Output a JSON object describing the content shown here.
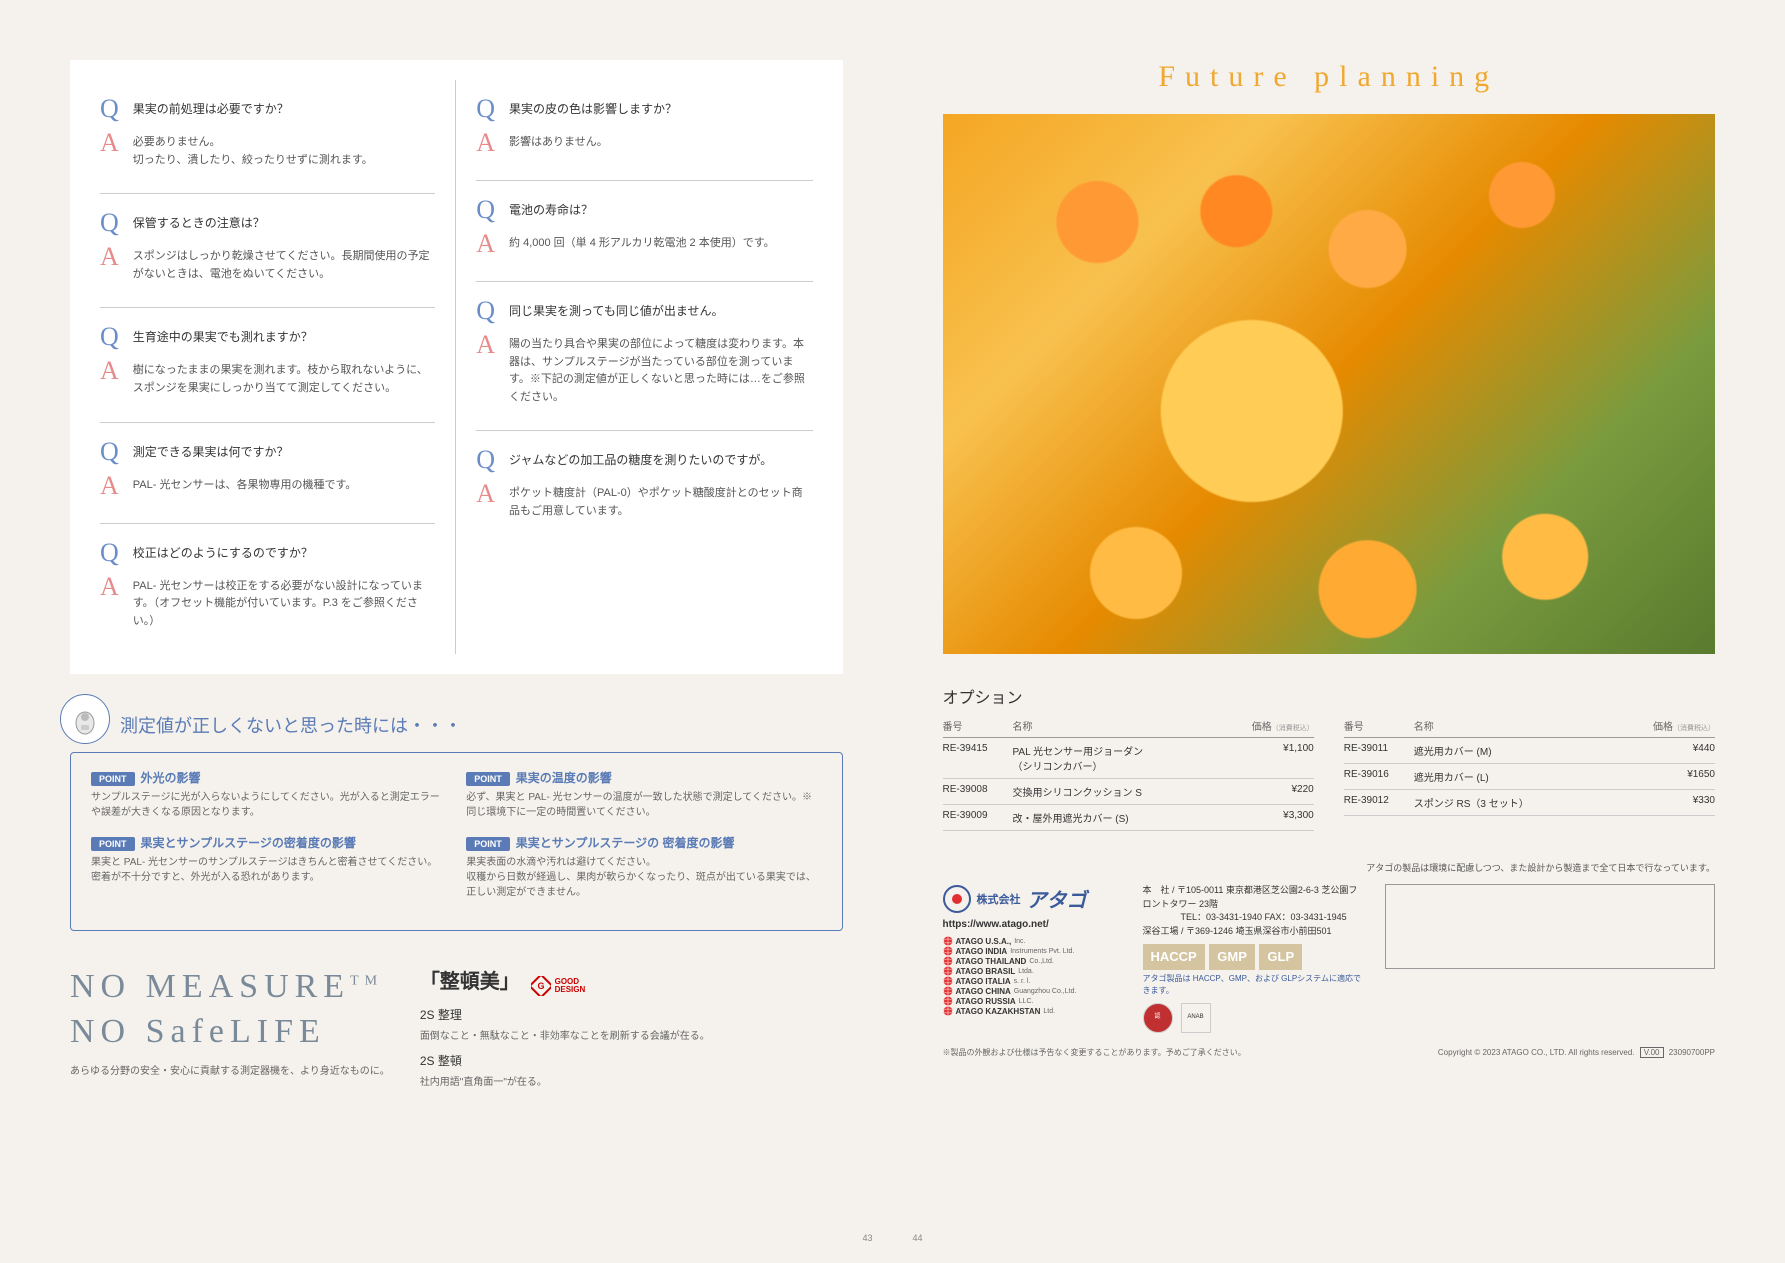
{
  "qa_left": [
    {
      "q": "果実の前処理は必要ですか？",
      "a": "必要ありません。\n切ったり、潰したり、絞ったりせずに測れます。"
    },
    {
      "q": "保管するときの注意は？",
      "a": "スポンジはしっかり乾燥させてください。長期間使用の予定がないときは、電池をぬいてください。"
    },
    {
      "q": "生育途中の果実でも測れますか？",
      "a": "樹になったままの果実を測れます。枝から取れないように、スポンジを果実にしっかり当てて測定してください。"
    },
    {
      "q": "測定できる果実は何ですか？",
      "a": "PAL- 光センサーは、各果物専用の機種です。"
    },
    {
      "q": "校正はどのようにするのですか？",
      "a": "PAL- 光センサーは校正をする必要がない設計になっています。（オフセット機能が付いています。P.3 をご参照ください。）"
    }
  ],
  "qa_right": [
    {
      "q": "果実の皮の色は影響しますか？",
      "a": "影響はありません。"
    },
    {
      "q": "電池の寿命は？",
      "a": "約 4,000 回（単 4 形アルカリ乾電池 2 本使用）です。"
    },
    {
      "q": "同じ果実を測っても同じ値が出ません。",
      "a": "陽の当たり具合や果実の部位によって糖度は変わります。本器は、サンプルステージが当たっている部位を測っています。※下記の測定値が正しくないと思った時には…をご参照ください。"
    },
    {
      "q": "ジャムなどの加工品の糖度を測りたいのですが。",
      "a": "ポケット糖度計（PAL-0）やポケット糖酸度計とのセット商品もご用意しています。"
    }
  ],
  "trouble": {
    "title": "測定値が正しくないと思った時には・・・",
    "point_label": "POINT",
    "points_left": [
      {
        "t": "外光の影響",
        "b": "サンプルステージに光が入らないようにしてください。光が入ると測定エラーや誤差が大きくなる原因となります。"
      },
      {
        "t": "果実とサンプルステージの密着度の影響",
        "b": "果実と PAL- 光センサーのサンプルステージはきちんと密着させてください。密着が不十分ですと、外光が入る恐れがあります。"
      }
    ],
    "points_right": [
      {
        "t": "果実の温度の影響",
        "b": "必ず、果実と PAL- 光センサーの温度が一致した状態で測定してください。※同じ環境下に一定の時間置いてください。"
      },
      {
        "t": "果実とサンプルステージの 密着度の影響",
        "b": "果実表面の水滴や汚れは避けてください。\n収穫から日数が経過し、果肉が軟らかくなったり、斑点が出ている果実では、正しい測定ができません。"
      }
    ]
  },
  "brand": {
    "line1": "NO MEASURE",
    "tm": "TM",
    "line2": "NO SafeLIFE",
    "sub": "あらゆる分野の安全・安心に貢献する測定器機を、より身近なものに。"
  },
  "seiton": {
    "heading": "「整頓美」",
    "good_design": "GOOD\nDESIGN",
    "s1": "2S 整理",
    "s1d": "面倒なこと・無駄なこと・非効率なことを刷新する会議が在る。",
    "s2": "2S 整頓",
    "s2d": "社内用語\"直角面一\"が在る。"
  },
  "future": {
    "title": "Future planning"
  },
  "options": {
    "title": "オプション",
    "hdr1": "番号",
    "hdr2": "名称",
    "hdr3": "価格",
    "hdr3note": "（消費税込）",
    "left": [
      {
        "no": "RE-39415",
        "name": "PAL 光センサー用ジョーダン\n（シリコンカバー）",
        "price": "¥1,100"
      },
      {
        "no": "RE-39008",
        "name": "交換用シリコンクッション S",
        "price": "¥220"
      },
      {
        "no": "RE-39009",
        "name": "改・屋外用遮光カバー (S)",
        "price": "¥3,300"
      }
    ],
    "right": [
      {
        "no": "RE-39011",
        "name": "遮光用カバー (M)",
        "price": "¥440"
      },
      {
        "no": "RE-39016",
        "name": "遮光用カバー (L)",
        "price": "¥1650"
      },
      {
        "no": "RE-39012",
        "name": "スポンジ RS（3 セット）",
        "price": "¥330"
      }
    ]
  },
  "company": {
    "eco": "アタゴの製品は環境に配慮しつつ、また設計から製造まで全て日本で行なっています。",
    "kk": "株式会社",
    "name": "アタゴ",
    "url": "https://www.atago.net/",
    "subs": [
      {
        "n": "ATAGO U.S.A.,",
        "s": "Inc."
      },
      {
        "n": "ATAGO INDIA",
        "s": "Instruments Pvt. Ltd."
      },
      {
        "n": "ATAGO THAILAND",
        "s": "Co.,Ltd."
      },
      {
        "n": "ATAGO BRASIL",
        "s": "Ltda."
      },
      {
        "n": "ATAGO ITALIA",
        "s": "s. r. l."
      },
      {
        "n": "ATAGO CHINA",
        "s": "Guangzhou Co.,Ltd."
      },
      {
        "n": "ATAGO RUSSIA",
        "s": "LLC."
      },
      {
        "n": "ATAGO KAZAKHSTAN",
        "s": "Ltd."
      }
    ],
    "addr1": "本　社 / 〒105-0011 東京都港区芝公園2-6-3 芝公園フロントタワー 23階",
    "addr1tel": "TEL：03-3431-1940 FAX：03-3431-1945",
    "addr2": "深谷工場 / 〒369-1246 埼玉県深谷市小前田501",
    "cert1": "HACCP",
    "cert2": "GMP",
    "cert3": "GLP",
    "cert_text": "アタゴ製品は HACCP、GMP、および GLPシステムに適応できます。",
    "disclaimer": "※製品の外観および仕様は予告なく変更することがあります。予めご了承ください。",
    "copyright": "Copyright © 2023 ATAGO CO., LTD. All rights reserved.",
    "ver": "V.00",
    "code": "23090700PP"
  },
  "pages": {
    "left": "43",
    "right": "44"
  }
}
